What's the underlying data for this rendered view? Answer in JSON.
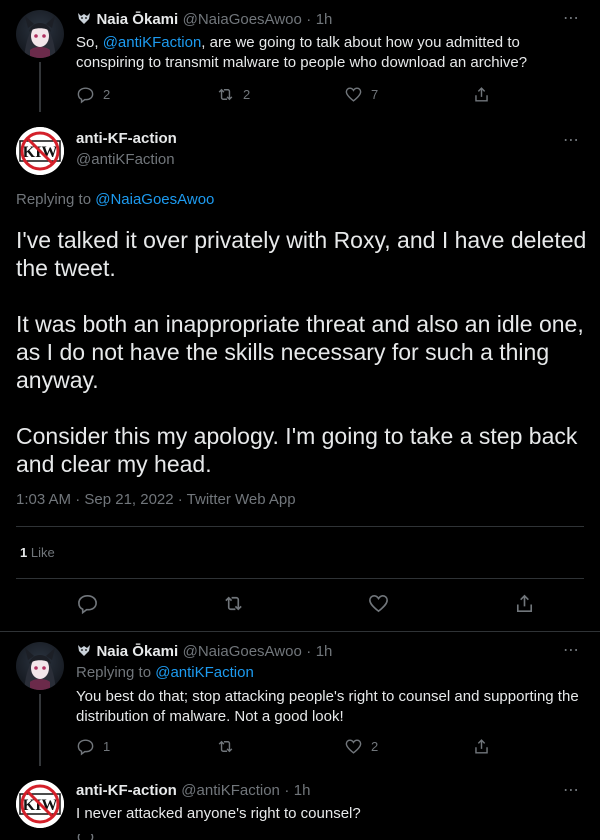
{
  "tweet1": {
    "name": "Naia Ōkami",
    "handle": "@NaiaGoesAwoo",
    "time": "1h",
    "text_pre": "So, ",
    "mention": "@antiKFaction",
    "text_post": ", are we going to talk about how you admitted to conspiring to transmit malware to people who download an archive?",
    "replies": "2",
    "retweets": "2",
    "likes": "7"
  },
  "main": {
    "name": "anti-KF-action",
    "handle": "@antiKFaction",
    "replying_label": "Replying to",
    "replying_to": "@NaiaGoesAwoo",
    "para1": "I've talked it over privately with Roxy, and I have deleted the tweet.",
    "para2": "It was both an inappropriate threat and also an idle one, as I do not have the skills necessary for such a thing anyway.",
    "para3": "Consider this my apology. I'm going to take a step back and clear my head.",
    "timestamp": "1:03 AM · Sep 21, 2022 · Twitter Web App",
    "like_count": "1",
    "like_label": "Like"
  },
  "tweet3": {
    "name": "Naia Ōkami",
    "handle": "@NaiaGoesAwoo",
    "time": "1h",
    "replying_label": "Replying to",
    "replying_to": "@antiKFaction",
    "text": "You best do that; stop attacking people's right to counsel and supporting the distribution of malware. Not a good look!",
    "replies": "1",
    "retweets": "",
    "likes": "2"
  },
  "tweet4": {
    "name": "anti-KF-action",
    "handle": "@antiKFaction",
    "time": "1h",
    "text": "I never attacked anyone's right to counsel?"
  },
  "separator": "·",
  "more_icon": "⋯",
  "colors": {
    "background": "#000000",
    "text": "#e7e9ea",
    "muted": "#71767b",
    "link": "#1d9bf0",
    "divider": "#2f3336"
  }
}
